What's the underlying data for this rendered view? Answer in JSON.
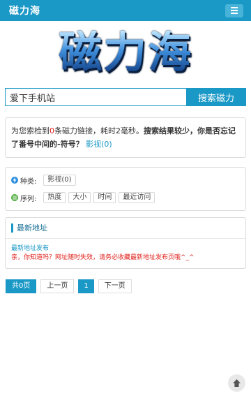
{
  "nav": {
    "brand": "磁力海",
    "menu_icon": "hamburger-icon"
  },
  "logo": {
    "text": "磁力海"
  },
  "search": {
    "value": "爱下手机站",
    "button_label": "搜索磁力"
  },
  "result": {
    "prefix": "为您索检到",
    "count": "0",
    "middle": "条磁力链接，耗时2毫秒。",
    "hint": "搜索结果较少，你是否忘记了番号中间的-符号？",
    "link": "影视(0)"
  },
  "filters": {
    "category_label": "种类:",
    "category_icon": "lightning-icon",
    "categories": [
      "影视(0)"
    ],
    "sort_label": "序列:",
    "sort_icon": "list-icon",
    "sorts": [
      "热度",
      "大小",
      "时间",
      "最近访问"
    ]
  },
  "address": {
    "title": "最新地址",
    "link": "最新地址发布",
    "notice": "亲，你知道吗？网址随时失效，请务必收藏最新地址发布页哦^_^"
  },
  "pager": {
    "total": "共0页",
    "prev": "上一页",
    "current": "1",
    "next": "下一页"
  },
  "back_to_top_icon": "arrow-up-icon",
  "colors": {
    "primary": "#1a98c6",
    "warning": "#e0211c"
  }
}
